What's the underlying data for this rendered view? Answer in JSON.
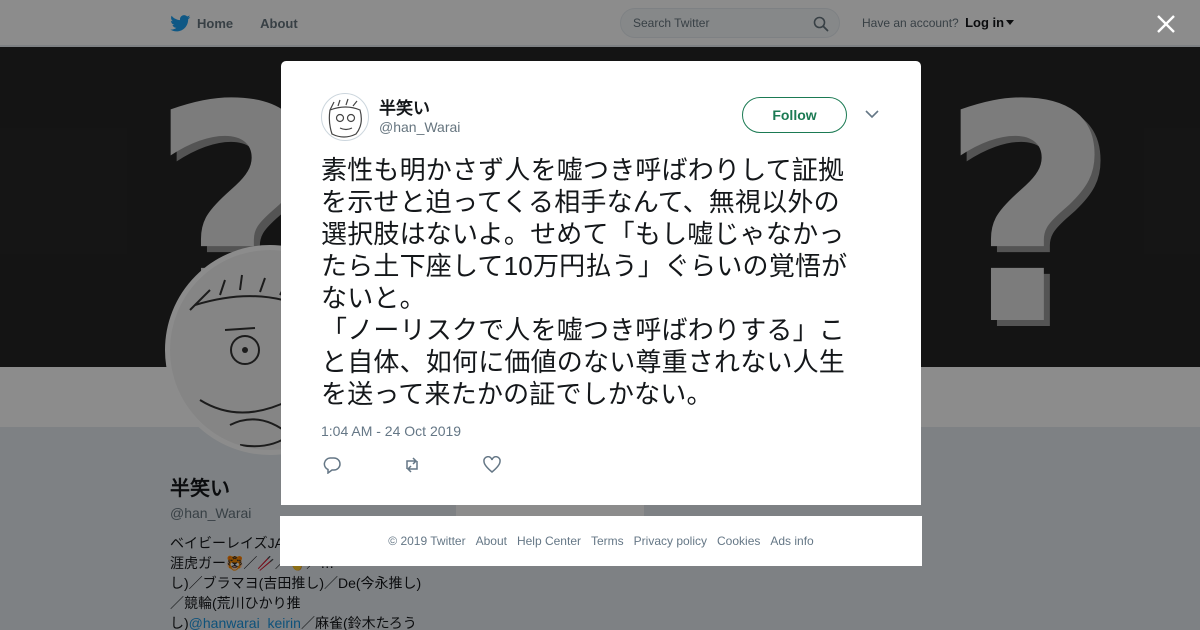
{
  "nav": {
    "home": "Home",
    "about": "About"
  },
  "search": {
    "placeholder": "Search Twitter"
  },
  "account": {
    "prompt": "Have an account?",
    "login": "Log in"
  },
  "profile": {
    "name": "半笑い",
    "handle": "@han_Warai",
    "bio_lines": [
      "ベイビーレイズJA",
      "涯虎ガー🐯／🥢／🤚／…",
      "し)／ブラマヨ(吉田推し)／De(今永推し)",
      "／競輪(荒川ひかり推",
      "し)"
    ],
    "bio_link": "@hanwarai_keirin",
    "bio_tail": "／麻雀(鈴木たろう"
  },
  "tweet": {
    "author_name": "半笑い",
    "author_handle": "@han_Warai",
    "follow_label": "Follow",
    "text": "素性も明かさず人を嘘つき呼ばわりして証拠\nを示せと迫ってくる相手なんて、無視以外の\n選択肢はないよ。せめて「もし嘘じゃなかっ\nたら土下座して10万円払う」ぐらいの覚悟が\nないと。\n「ノーリスクで人を嘘つき呼ばわりする」こ\nと自体、如何に価値のない尊重されない人生\nを送って来たかの証でしかない。",
    "timestamp": "1:04 AM - 24 Oct 2019"
  },
  "icons": [
    "twitter-bird-icon",
    "search-icon",
    "close-icon",
    "chevron-down-icon",
    "reply-icon",
    "retweet-icon",
    "like-icon"
  ],
  "footer": [
    "© 2019 Twitter",
    "About",
    "Help Center",
    "Terms",
    "Privacy policy",
    "Cookies",
    "Ads info"
  ],
  "colors": {
    "twitter_blue": "#1da1f2",
    "follow_green": "#1b7a53"
  }
}
